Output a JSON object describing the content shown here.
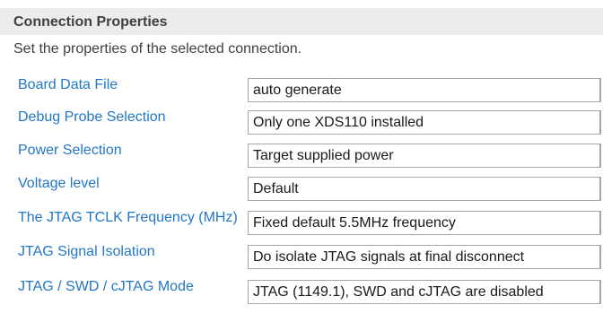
{
  "section": {
    "title": "Connection Properties",
    "description": "Set the properties of the selected connection."
  },
  "properties": [
    {
      "label": "Board Data File",
      "value": "auto generate"
    },
    {
      "label": "Debug Probe Selection",
      "value": "Only one XDS110 installed"
    },
    {
      "label": "Power Selection",
      "value": "Target supplied power"
    },
    {
      "label": "Voltage level",
      "value": "Default"
    },
    {
      "label": "The JTAG TCLK Frequency (MHz)",
      "value": "Fixed default 5.5MHz frequency"
    },
    {
      "label": "JTAG Signal Isolation",
      "value": "Do isolate JTAG signals at final disconnect"
    },
    {
      "label": "JTAG / SWD / cJTAG Mode",
      "value": "JTAG (1149.1), SWD and cJTAG are disabled"
    }
  ],
  "colors": {
    "label_link": "#2277c6",
    "header_bg": "#ececec",
    "field_border": "#a6a6a6"
  }
}
